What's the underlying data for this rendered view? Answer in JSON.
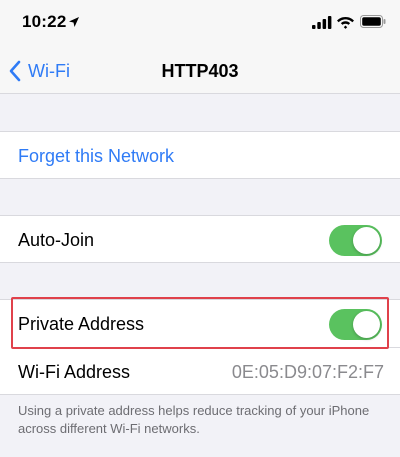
{
  "status_bar": {
    "time": "10:22",
    "icons": [
      "location-arrow-icon",
      "cellular-signal-icon",
      "wifi-icon",
      "battery-icon"
    ]
  },
  "nav": {
    "back_label": "Wi-Fi",
    "title": "HTTP403"
  },
  "forget": {
    "label": "Forget this Network"
  },
  "auto_join": {
    "label": "Auto-Join",
    "on": true
  },
  "private_address": {
    "label": "Private Address",
    "on": true
  },
  "wifi_address": {
    "label": "Wi-Fi Address",
    "value": "0E:05:D9:07:F2:F7"
  },
  "footer": {
    "text": "Using a private address helps reduce tracking of your iPhone across different Wi-Fi networks."
  },
  "colors": {
    "accent": "#2f7bf6",
    "toggle_on": "#5ac25f",
    "highlight": "#e0414b",
    "background": "#f2f2f7"
  }
}
